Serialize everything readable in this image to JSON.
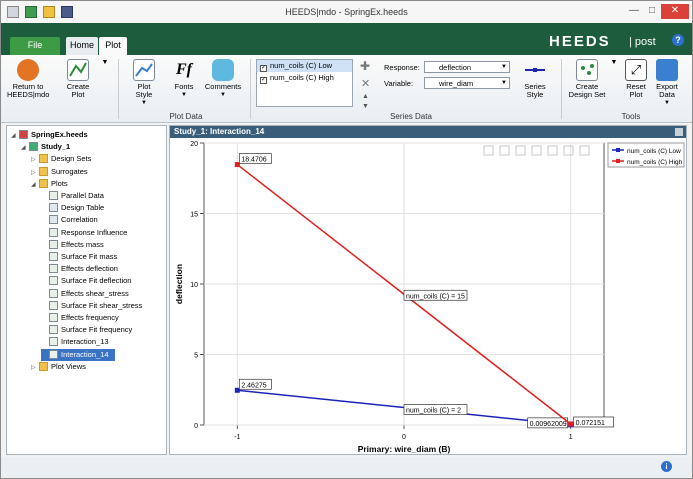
{
  "window": {
    "title": "HEEDS|mdo - SpringEx.heeds",
    "min": "—",
    "max": "□",
    "close": "✕"
  },
  "tabs": {
    "file": "File",
    "home": "Home",
    "plot": "Plot"
  },
  "logo": {
    "brand": "HEEDS",
    "sub": "| post"
  },
  "ribbon": {
    "return": "Return to\nHEEDS|mdo",
    "create_plot": "Create\nPlot",
    "plot_style": "Plot\nStyle",
    "fonts": "Fonts",
    "comments": "Comments",
    "group_plot_data": "Plot Data",
    "group_series_data": "Series Data",
    "group_tools": "Tools",
    "series_items": [
      "num_coils (C) Low",
      "num_coils (C) High"
    ],
    "response_label": "Response:",
    "response_value": "deflection",
    "variable_label": "Variable:",
    "variable_value": "wire_diam",
    "series_style": "Series\nStyle",
    "create_design_set": "Create\nDesign Set",
    "reset_plot": "Reset\nPlot",
    "export_data": "Export\nData"
  },
  "tree": [
    {
      "label": "SpringEx.heeds",
      "bold": true,
      "indent": 0,
      "icon": "project",
      "exp": "◢"
    },
    {
      "label": "Study_1",
      "bold": true,
      "indent": 1,
      "icon": "study",
      "exp": "◢"
    },
    {
      "label": "Design Sets",
      "indent": 2,
      "icon": "folder",
      "exp": "▷"
    },
    {
      "label": "Surrogates",
      "indent": 2,
      "icon": "folder",
      "exp": "▷"
    },
    {
      "label": "Plots",
      "indent": 2,
      "icon": "folder",
      "exp": "◢"
    },
    {
      "label": "Parallel Data",
      "indent": 3,
      "icon": "plot"
    },
    {
      "label": "Design Table",
      "indent": 3,
      "icon": "table"
    },
    {
      "label": "Correlation",
      "indent": 3,
      "icon": "table"
    },
    {
      "label": "Response Influence",
      "indent": 3,
      "icon": "plot"
    },
    {
      "label": "Effects mass",
      "indent": 3,
      "icon": "plot"
    },
    {
      "label": "Surface Fit mass",
      "indent": 3,
      "icon": "plot"
    },
    {
      "label": "Effects deflection",
      "indent": 3,
      "icon": "plot"
    },
    {
      "label": "Surface Fit deflection",
      "indent": 3,
      "icon": "plot"
    },
    {
      "label": "Effects shear_stress",
      "indent": 3,
      "icon": "plot"
    },
    {
      "label": "Surface Fit shear_stress",
      "indent": 3,
      "icon": "plot"
    },
    {
      "label": "Effects frequency",
      "indent": 3,
      "icon": "plot"
    },
    {
      "label": "Surface Fit frequency",
      "indent": 3,
      "icon": "plot"
    },
    {
      "label": "Interaction_13",
      "indent": 3,
      "icon": "plot"
    },
    {
      "label": "Interaction_14",
      "indent": 3,
      "icon": "plot",
      "selected": true
    },
    {
      "label": "Plot Views",
      "indent": 2,
      "icon": "folder",
      "exp": "▷"
    }
  ],
  "plot_header": "Study_1: Interaction_14",
  "chart_data": {
    "type": "line",
    "xlabel": "Primary: wire_diam (B)",
    "ylabel": "deflection",
    "xlim": [
      -1.2,
      1.2
    ],
    "ylim": [
      0,
      20
    ],
    "xticks": [
      -1,
      0,
      1
    ],
    "yticks": [
      0,
      5,
      10,
      15,
      20
    ],
    "series": [
      {
        "name": "num_coils (C) Low",
        "color": "#1c23b8",
        "x": [
          -1,
          1
        ],
        "y": [
          2.46275,
          0.00962009
        ],
        "labels": [
          "2.46275",
          "0.00962009"
        ],
        "annotation": "num_coils (C) = 2"
      },
      {
        "name": "num_coils (C) High",
        "color": "#e02020",
        "x": [
          -1,
          1
        ],
        "y": [
          18.4706,
          0.072151
        ],
        "labels": [
          "18.4706",
          "0.072151"
        ],
        "annotation": "num_coils (C) = 15"
      }
    ]
  }
}
